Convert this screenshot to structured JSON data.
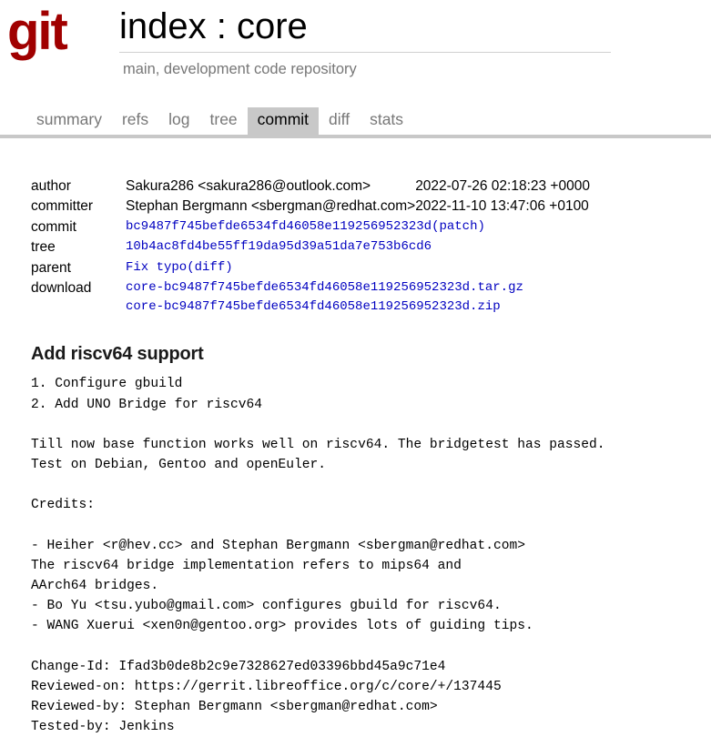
{
  "header": {
    "logo_text": "git",
    "title": "index : core",
    "subtitle": "main, development code repository"
  },
  "tabs": [
    {
      "label": "summary",
      "active": false
    },
    {
      "label": "refs",
      "active": false
    },
    {
      "label": "log",
      "active": false
    },
    {
      "label": "tree",
      "active": false
    },
    {
      "label": "commit",
      "active": true
    },
    {
      "label": "diff",
      "active": false
    },
    {
      "label": "stats",
      "active": false
    }
  ],
  "commit_info": {
    "author_label": "author",
    "author_value": "Sakura286 <sakura286@outlook.com>",
    "author_date": "2022-07-26 02:18:23 +0000",
    "committer_label": "committer",
    "committer_value": "Stephan Bergmann <sbergman@redhat.com>",
    "committer_date": "2022-11-10 13:47:06 +0100",
    "commit_label": "commit",
    "commit_hash": "bc9487f745befde6534fd46058e119256952323d",
    "commit_patch_open": "(",
    "commit_patch_label": "patch",
    "commit_patch_close": ")",
    "tree_label": "tree",
    "tree_hash": "10b4ac8fd4be55ff19da95d39a51da7e753b6cd6",
    "parent_label": "parent",
    "parent_value": "Fix typo",
    "parent_diff_open": "(",
    "parent_diff_label": "diff",
    "parent_diff_close": ")",
    "download_label": "download",
    "download_targz": "core-bc9487f745befde6534fd46058e119256952323d.tar.gz",
    "download_zip": "core-bc9487f745befde6534fd46058e119256952323d.zip"
  },
  "message": {
    "subject": "Add riscv64 support",
    "body": "1. Configure gbuild\n2. Add UNO Bridge for riscv64\n\nTill now base function works well on riscv64. The bridgetest has passed.\nTest on Debian, Gentoo and openEuler.\n\nCredits:\n\n- Heiher <r@hev.cc> and Stephan Bergmann <sbergman@redhat.com>\nThe riscv64 bridge implementation refers to mips64 and\nAArch64 bridges.\n- Bo Yu <tsu.yubo@gmail.com> configures gbuild for riscv64.\n- WANG Xuerui <xen0n@gentoo.org> provides lots of guiding tips.\n\nChange-Id: Ifad3b0de8b2c9e7328627ed03396bbd45a9c71e4\nReviewed-on: https://gerrit.libreoffice.org/c/core/+/137445\nReviewed-by: Stephan Bergmann <sbergman@redhat.com>\nTested-by: Jenkins"
  },
  "colors": {
    "logo_red": "#a00000",
    "link_blue": "#0000c0",
    "tab_active_bg": "#c8c8c8",
    "tab_inactive_text": "#777777",
    "rule_gray": "#c8c8c8"
  }
}
